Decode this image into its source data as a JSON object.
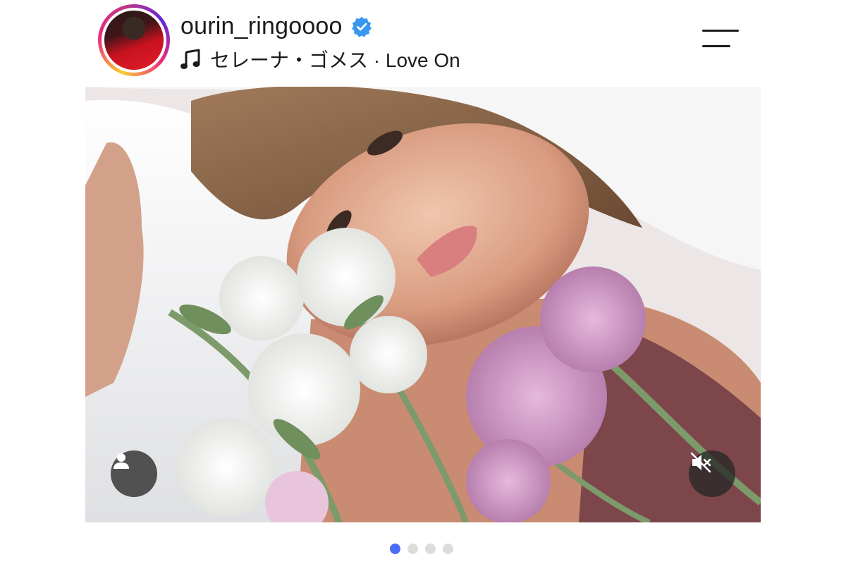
{
  "profile": {
    "username": "ourin_ringoooo",
    "verified": true,
    "avatar_icon": "profile-photo"
  },
  "music": {
    "icon": "music-note-icon",
    "track_text": "セレーナ・ゴメス · Love On"
  },
  "header": {
    "menu_icon": "hamburger-menu-icon"
  },
  "post": {
    "photo": "woman-lying-on-white-pillow-with-flowers",
    "tag_button_icon": "user-tag-icon",
    "mute_button_icon": "speaker-muted-icon"
  },
  "carousel": {
    "total": 4,
    "active_index": 0
  },
  "colors": {
    "verified_blue": "#3897f0",
    "active_dot": "#4a6cf7",
    "inactive_dot": "#dcdcdc"
  }
}
